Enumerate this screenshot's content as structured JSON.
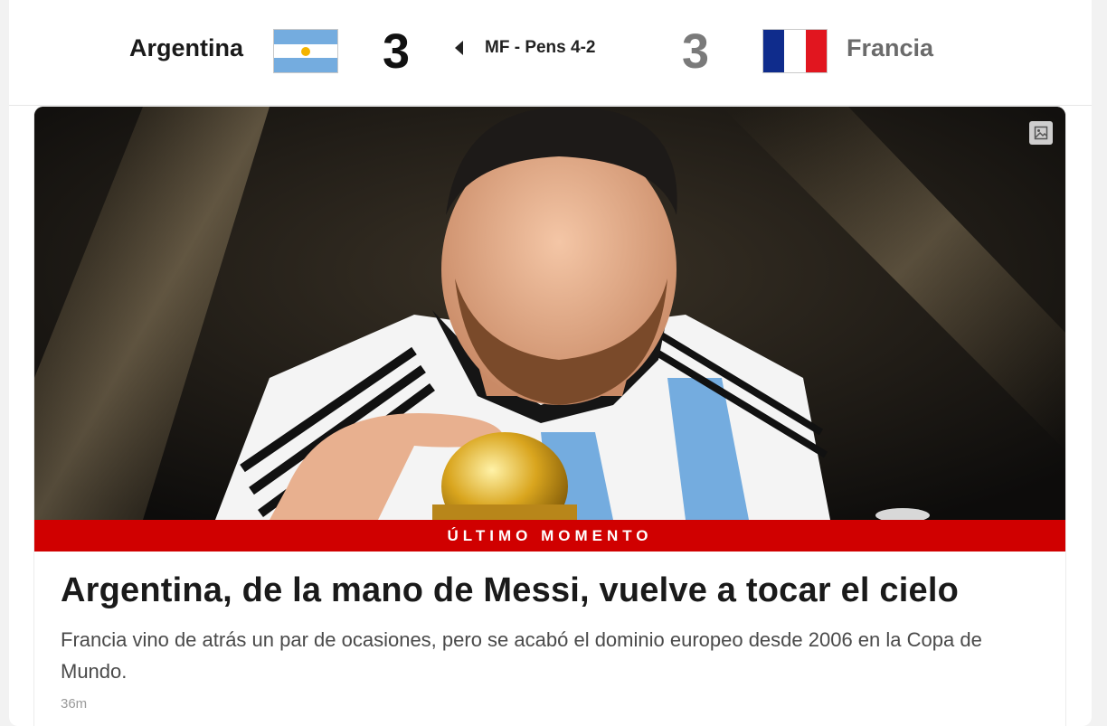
{
  "scoreboard": {
    "home": {
      "name": "Argentina",
      "score": "3"
    },
    "away": {
      "name": "Francia",
      "score": "3"
    },
    "status": "MF - Pens 4-2"
  },
  "colors": {
    "banner": "#d00000",
    "argentina_blue": "#74acdf",
    "france_blue": "#0f2c8c",
    "france_red": "#e1161f"
  },
  "article": {
    "banner_label": "ÚLTIMO MOMENTO",
    "headline": "Argentina, de la mano de Messi, vuelve a tocar el cielo",
    "summary": "Francia vino de atrás un par de ocasiones, pero se acabó el dominio europeo desde 2006 en la Copa de Mundo.",
    "time_ago": "36m",
    "image_icon": "image-icon"
  }
}
